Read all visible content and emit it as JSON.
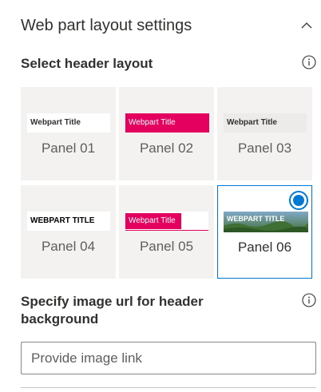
{
  "section": {
    "title": "Web part layout settings",
    "collapse_icon": "chevron-up-icon"
  },
  "header_layout": {
    "label": "Select header layout",
    "info_icon": "info-icon",
    "selected": "Panel 06",
    "panels": [
      {
        "label": "Panel 01",
        "preview_text": "Webpart Title",
        "style": "white-bar"
      },
      {
        "label": "Panel 02",
        "preview_text": "Webpart Title",
        "style": "magenta-bar",
        "accent_color": "#e3005f"
      },
      {
        "label": "Panel 03",
        "preview_text": "Webpart Title",
        "style": "grey-bar"
      },
      {
        "label": "Panel 04",
        "preview_text": "WEBPART TITLE",
        "style": "white-uppercase"
      },
      {
        "label": "Panel 05",
        "preview_text": "Webpart Title",
        "style": "magenta-partial",
        "accent_color": "#e3005f"
      },
      {
        "label": "Panel 06",
        "preview_text": "WEBPART TITLE",
        "style": "image-background"
      }
    ]
  },
  "image_url": {
    "label": "Specify image url for header background",
    "info_icon": "info-icon",
    "placeholder": "Provide image link",
    "value": ""
  },
  "colors": {
    "accent": "#0078d4",
    "magenta": "#e3005f",
    "tile_background": "#f3f2f1"
  }
}
